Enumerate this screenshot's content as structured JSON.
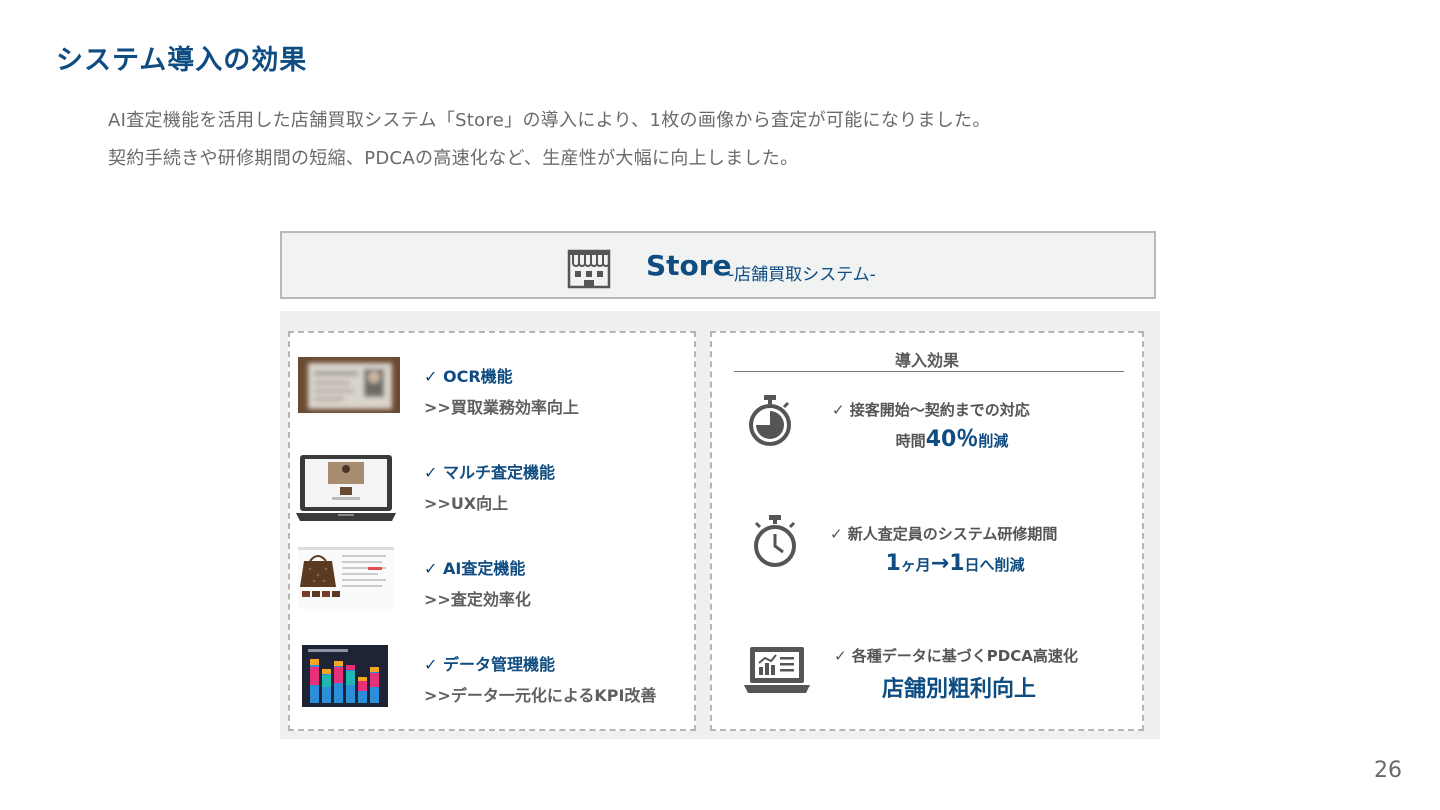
{
  "page": {
    "title": "システム導入の効果",
    "intro_line1": "AI査定機能を活用した店舗買取システム「Store」の導入により、1枚の画像から査定が可能になりました。",
    "intro_line2": "契約手続きや研修期間の短縮、PDCAの高速化など、生産性が大幅に向上しました。",
    "page_number": "26"
  },
  "store": {
    "name": "Store",
    "subtitle": "-店舗買取システム-",
    "icon": "storefront-icon"
  },
  "features": [
    {
      "label": "✓  OCR機能",
      "desc": ">>買取業務効率向上",
      "image": "id-card-photo"
    },
    {
      "label": "✓  マルチ査定機能",
      "desc": ">>UX向上",
      "image": "laptop-multi-assessment"
    },
    {
      "label": "✓  AI査定機能",
      "desc": ">>査定効率化",
      "image": "bag-assessment-screen"
    },
    {
      "label": "✓  データ管理機能",
      "desc": ">>データ一元化によるKPI改善",
      "image": "dashboard-bar-chart"
    }
  ],
  "effects": {
    "title": "導入効果",
    "items": [
      {
        "icon": "timer-icon",
        "line1": "✓  接客開始～契約までの対応",
        "line2_pre": "時間",
        "line2_big": "40％",
        "line2_post": "削減"
      },
      {
        "icon": "stopwatch-icon",
        "line1": "✓  新人査定員のシステム研修期間",
        "line2_big1": "1",
        "line2_small1": "ヶ月",
        "line2_big2": "→1",
        "line2_small2": "日へ削減"
      },
      {
        "icon": "laptop-analytics-icon",
        "line1": "✓  各種データに基づくPDCA高速化",
        "line2": "店舗別粗利向上"
      }
    ]
  },
  "colors": {
    "accent": "#0f4c81",
    "panel_bg": "#eef0f0",
    "text_gray": "#555555"
  }
}
